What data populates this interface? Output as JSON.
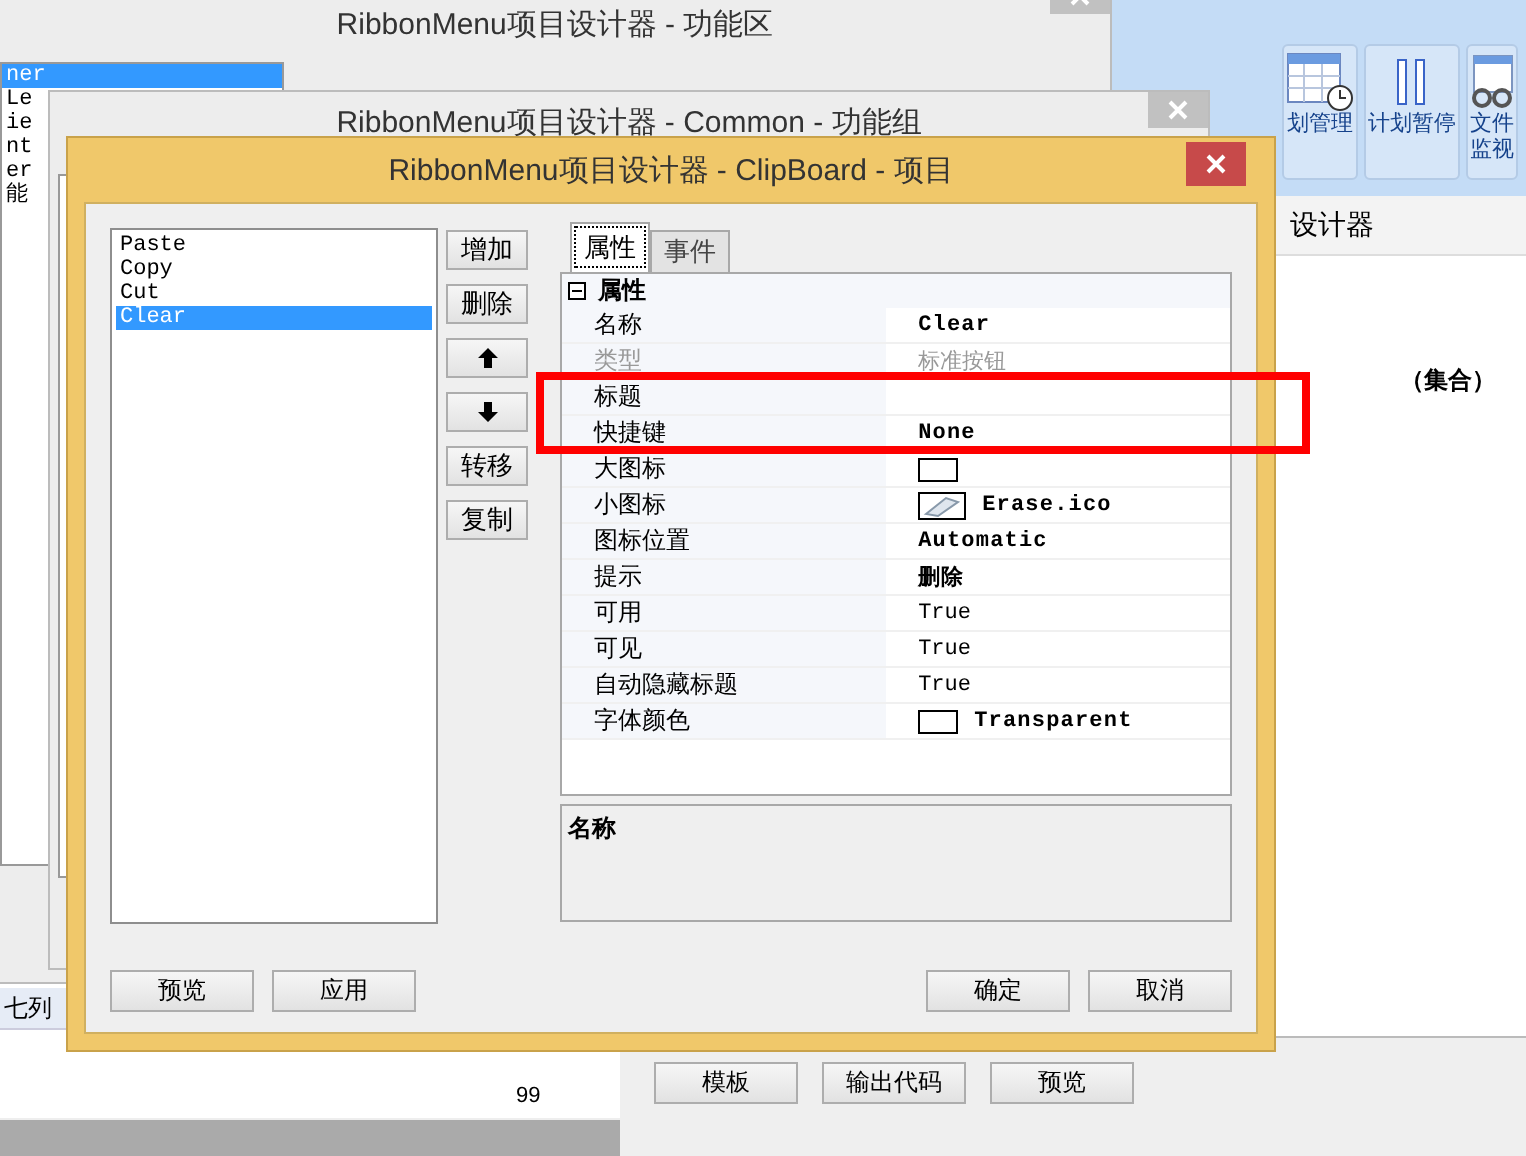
{
  "host_app": {
    "ribbon_items": [
      {
        "kind": "calendar",
        "lines": [
          "划管理"
        ]
      },
      {
        "kind": "pause",
        "lines": [
          "计划暂停"
        ]
      },
      {
        "kind": "glasses",
        "lines": [
          "文件",
          "监视"
        ]
      }
    ],
    "designer_title": "设计器",
    "column_header": "（集合）",
    "buttons": [
      "模板",
      "输出代码",
      "预览"
    ]
  },
  "grid_behind": {
    "header": "七列",
    "rows": [
      "99"
    ]
  },
  "area_window": {
    "title": "RibbonMenu项目设计器 - 功能区",
    "list": [
      {
        "label": "ner",
        "selected": true
      },
      {
        "label": "Le",
        "selected": false
      },
      {
        "label": "ie",
        "selected": false
      },
      {
        "label": "nt",
        "selected": false
      },
      {
        "label": "er",
        "selected": false
      },
      {
        "label": "能",
        "selected": false
      }
    ]
  },
  "group_window": {
    "title": "RibbonMenu项目设计器 - Common - 功能组"
  },
  "dialog": {
    "title": "RibbonMenu项目设计器 - ClipBoard - 项目",
    "items": [
      {
        "label": "Paste",
        "selected": false
      },
      {
        "label": "Copy",
        "selected": false
      },
      {
        "label": "Cut",
        "selected": false
      },
      {
        "label": "Clear",
        "selected": true
      }
    ],
    "side_buttons": [
      {
        "kind": "text",
        "label": "增加"
      },
      {
        "kind": "text",
        "label": "删除"
      },
      {
        "kind": "up"
      },
      {
        "kind": "down"
      },
      {
        "kind": "text",
        "label": "转移"
      },
      {
        "kind": "text",
        "label": "复制"
      }
    ],
    "tabs": [
      {
        "label": "属性",
        "selected": true
      },
      {
        "label": "事件",
        "selected": false
      }
    ],
    "category": {
      "label": "属性",
      "expanded": true
    },
    "properties": [
      {
        "name": "名称",
        "value": "Clear",
        "kind": "text",
        "bold": true,
        "disabled": false
      },
      {
        "name": "类型",
        "value": "标准按钮",
        "kind": "text",
        "bold": false,
        "disabled": true
      },
      {
        "name": "标题",
        "kind": "text",
        "disabled": false
      },
      {
        "name": "快捷键",
        "value": "None",
        "kind": "text",
        "bold": true,
        "disabled": false
      },
      {
        "name": "大图标",
        "kind": "swatch",
        "disabled": false
      },
      {
        "name": "小图标",
        "value": "Erase.ico",
        "kind": "eraser",
        "bold": true,
        "disabled": false
      },
      {
        "name": "图标位置",
        "value": "Automatic",
        "kind": "text",
        "bold": true,
        "disabled": false
      },
      {
        "name": "提示",
        "value": "删除",
        "kind": "text",
        "bold": true,
        "disabled": false
      },
      {
        "name": "可用",
        "value": "True",
        "kind": "text",
        "bold": false,
        "disabled": false
      },
      {
        "name": "可见",
        "value": "True",
        "kind": "text",
        "bold": false,
        "disabled": false
      },
      {
        "name": "自动隐藏标题",
        "value": "True",
        "kind": "text",
        "bold": false,
        "disabled": false
      },
      {
        "name": "字体颜色",
        "value": "Transparent",
        "kind": "swatch",
        "bold": true,
        "disabled": false
      }
    ],
    "description_title": "名称",
    "footer_left": [
      "预览",
      "应用"
    ],
    "footer_right": [
      "确定",
      "取消"
    ]
  }
}
